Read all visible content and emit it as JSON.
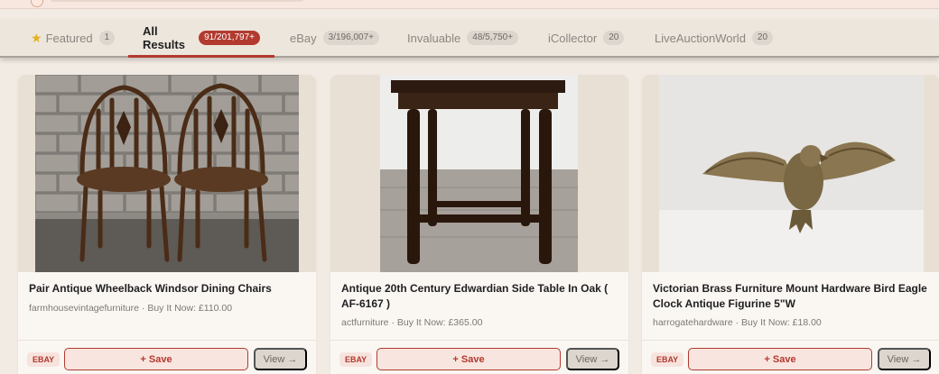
{
  "tabs": [
    {
      "label": "Featured",
      "count": "1",
      "icon": "star-icon"
    },
    {
      "label": "All Results",
      "count": "91/201,797+",
      "active": true
    },
    {
      "label": "eBay",
      "count": "3/196,007+"
    },
    {
      "label": "Invaluable",
      "count": "48/5,750+"
    },
    {
      "label": "iCollector",
      "count": "20"
    },
    {
      "label": "LiveAuctionWorld",
      "count": "20"
    }
  ],
  "cards": [
    {
      "title": "Pair Antique Wheelback Windsor Dining Chairs",
      "meta": "farmhousevintagefurniture · Buy It Now: £110.00",
      "source": "EBAY",
      "save_label": "+ Save",
      "view_label": "View →"
    },
    {
      "title": "Antique 20th Century Edwardian Side Table In Oak ( AF-6167 )",
      "meta": "actfurniture · Buy It Now: £365.00",
      "source": "EBAY",
      "save_label": "+ Save",
      "view_label": "View →"
    },
    {
      "title": "Victorian Brass Furniture Mount Hardware Bird Eagle Clock Antique Figurine 5\"W",
      "meta": "harrogatehardware · Buy It Now: £18.00",
      "source": "EBAY",
      "save_label": "+ Save",
      "view_label": "View →"
    }
  ],
  "colors": {
    "accent": "#b23a2f",
    "background": "#f2ebe3",
    "card": "#faf7f3"
  }
}
